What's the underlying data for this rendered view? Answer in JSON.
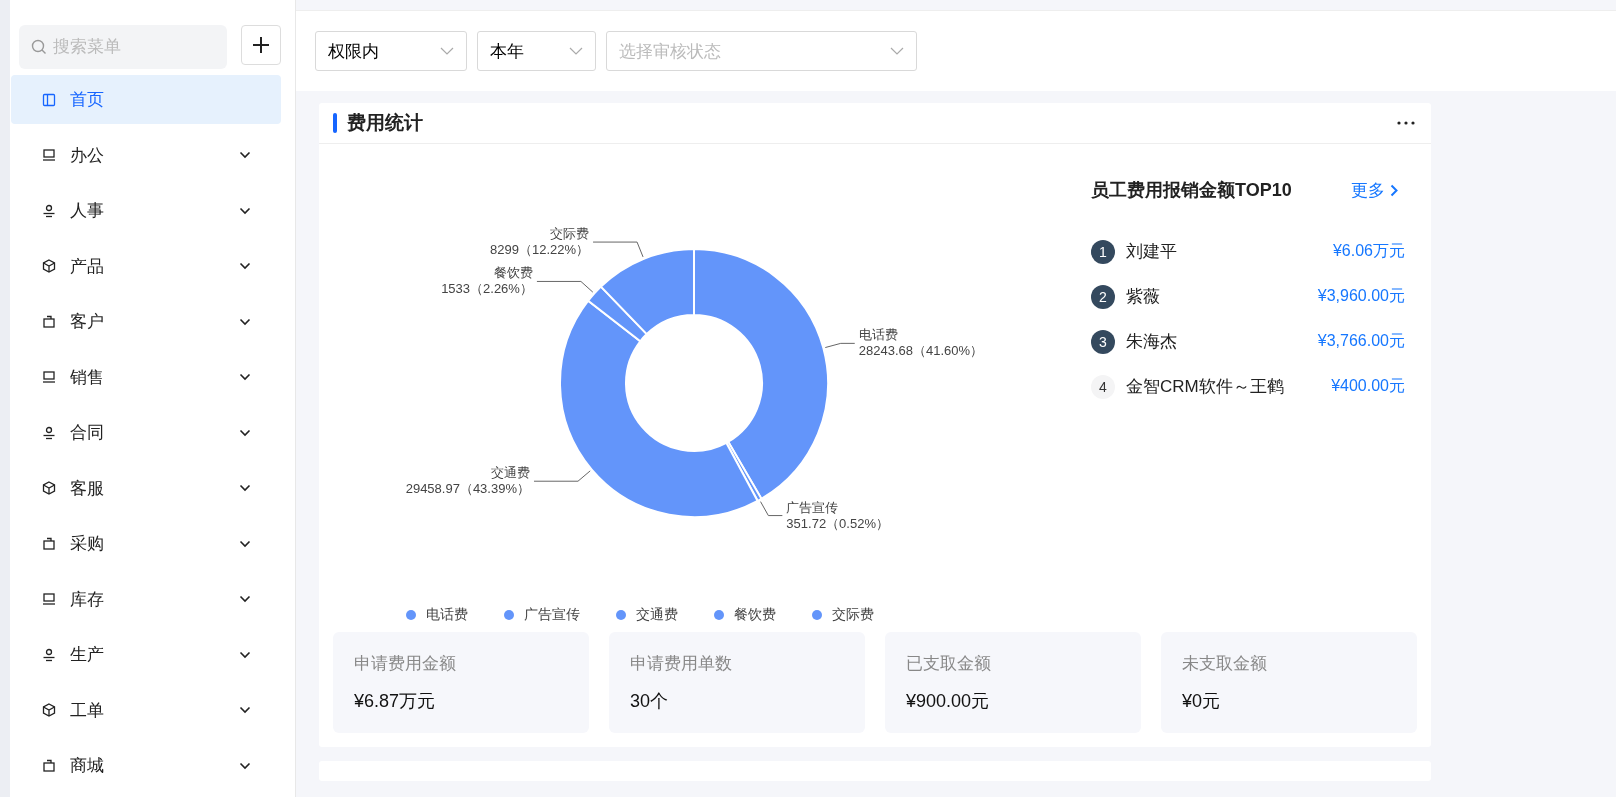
{
  "sidebar": {
    "search": {
      "placeholder": "搜索菜单"
    },
    "items": [
      {
        "label": "首页",
        "kind": "link",
        "selected": true
      },
      {
        "label": "办公",
        "kind": "group",
        "selected": false,
        "expanded": false
      },
      {
        "label": "人事",
        "kind": "group",
        "selected": false,
        "expanded": false
      },
      {
        "label": "产品",
        "kind": "group",
        "selected": false,
        "expanded": false
      },
      {
        "label": "客户",
        "kind": "group",
        "selected": false,
        "expanded": false
      },
      {
        "label": "销售",
        "kind": "group",
        "selected": false,
        "expanded": false
      },
      {
        "label": "合同",
        "kind": "group",
        "selected": false,
        "expanded": false
      },
      {
        "label": "客服",
        "kind": "group",
        "selected": false,
        "expanded": false
      },
      {
        "label": "采购",
        "kind": "group",
        "selected": false,
        "expanded": false
      },
      {
        "label": "库存",
        "kind": "group",
        "selected": false,
        "expanded": false
      },
      {
        "label": "生产",
        "kind": "group",
        "selected": false,
        "expanded": false
      },
      {
        "label": "工单",
        "kind": "group",
        "selected": false,
        "expanded": false
      },
      {
        "label": "商城",
        "kind": "group",
        "selected": false,
        "expanded": false
      }
    ]
  },
  "filters": [
    {
      "value": "权限内"
    },
    {
      "value": "本年"
    },
    {
      "placeholder": "选择审核状态"
    }
  ],
  "card": {
    "title": "费用统计",
    "chart_data": {
      "type": "donut",
      "categories": [
        "电话费",
        "广告宣传",
        "交通费",
        "餐饮费",
        "交际费"
      ],
      "values": [
        28243.68,
        351.72,
        29458.97,
        1533,
        8299
      ],
      "data_labels": true,
      "value_labels": [
        "28243.68（41.60%）",
        "351.72（0.52%）",
        "29458.97（43.39%）",
        "1533（2.26%）",
        "8299（12.22%）"
      ]
    },
    "ranking": {
      "title": "员工费用报销金额TOP10",
      "more": "更多",
      "rows": [
        {
          "rank": "1",
          "name": "刘建平",
          "amount": "¥6.06万元",
          "highlight": true
        },
        {
          "rank": "2",
          "name": "紫薇",
          "amount": "¥3,960.00元",
          "highlight": true
        },
        {
          "rank": "3",
          "name": "朱海杰",
          "amount": "¥3,766.00元",
          "highlight": true
        },
        {
          "rank": "4",
          "name": "金智CRM软件～王鹤",
          "amount": "¥400.00元",
          "highlight": false
        }
      ]
    },
    "stats": [
      {
        "label": "申请费用金额",
        "value": "¥6.87万元"
      },
      {
        "label": "申请费用单数",
        "value": "30个"
      },
      {
        "label": "已支取金额",
        "value": "¥900.00元"
      },
      {
        "label": "未支取金额",
        "value": "¥0元"
      }
    ]
  }
}
